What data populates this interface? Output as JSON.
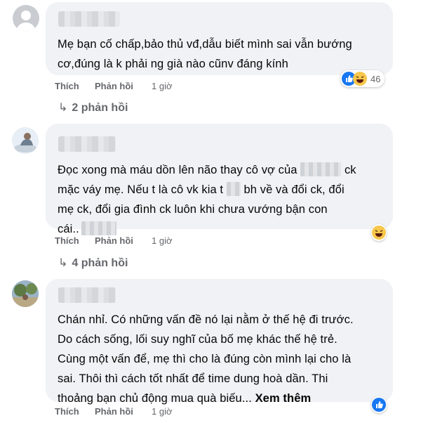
{
  "comments": [
    {
      "lines": [
        "Mẹ bạn cố chấp,bảo thủ vđ,dẫu biết mình sai vẫn bướng",
        "cơ,đúng là k phải ng già nào cũnv đáng kính"
      ],
      "like_label": "Thích",
      "reply_label": "Phản hồi",
      "time": "1 giờ",
      "reaction_count": "46",
      "replies_label": "2 phản hồi",
      "reactions": [
        "like-icon",
        "haha-icon"
      ]
    },
    {
      "line1a": "Đọc xong mà máu dồn lên não thay cô vợ của",
      "line1b": "ck",
      "line2a": "mặc váy mẹ. Nếu t là cô vk kia t",
      "line2b": "bh về và đổi ck, đổi",
      "line3": "mẹ ck, đổi gia đình ck luôn khi chưa vướng bận con",
      "line4": "cái..",
      "like_label": "Thích",
      "reply_label": "Phản hồi",
      "time": "1 giờ",
      "replies_label": "4 phản hồi",
      "reactions": [
        "haha-icon"
      ]
    },
    {
      "lines": [
        "Chán nhỉ. Có những vấn đề nó lại nằm ở thế hệ đi trước.",
        "Do cách sống, lối suy nghĩ của bố mẹ khác thế hệ trẻ.",
        "Cùng một vấn để, mẹ thì cho là đúng còn mình lại cho là",
        "sai. Thôi thì cách tốt nhất để time dung hoà dần. Thi"
      ],
      "last_line": "thoảng bạn chủ động mua quà biếu...",
      "see_more": "Xem thêm",
      "like_label": "Thích",
      "reply_label": "Phản hồi",
      "time": "1 giờ",
      "reactions": [
        "like-icon"
      ]
    }
  ],
  "colors": {
    "bubble": "#f0f2f5",
    "meta": "#65676b",
    "text": "#050505",
    "like": "#1877f2",
    "haha": "#f7c64b"
  }
}
